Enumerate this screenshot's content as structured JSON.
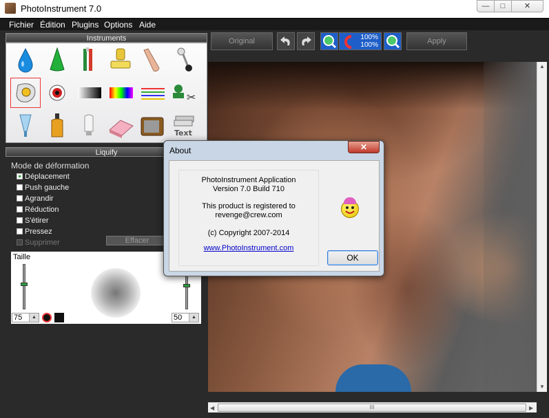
{
  "window": {
    "title": "PhotoInstrument 7.0",
    "min_glyph": "—",
    "max_glyph": "□",
    "close_glyph": "✕"
  },
  "menu": [
    "Fichier",
    "Édition",
    "Plugins",
    "Options",
    "Aide"
  ],
  "instruments": {
    "header": "Instruments"
  },
  "toolbar": {
    "original": "Original",
    "zoom_top": "100%",
    "zoom_bottom": "100%",
    "apply": "Apply"
  },
  "liquify": {
    "header": "Liquify",
    "mode_label": "Mode de déformation",
    "options": [
      "Déplacement",
      "Push gauche",
      "Agrandir",
      "Réduction",
      "S'étirer",
      "Pressez",
      "Supprimer"
    ],
    "selected": "Déplacement",
    "clear_button": "Effacer",
    "size_label": "Taille",
    "size_value": "75",
    "strength_value": "50"
  },
  "about": {
    "title": "About",
    "close_glyph": "✕",
    "app_name": "PhotoInstrument Application",
    "version": "Version 7.0 Build 710",
    "registered": "This product is registered to",
    "email": "revenge@crew.com",
    "copyright": "(c) Copyright 2007-2014",
    "website": "www.PhotoInstrument.com",
    "ok_label": "OK"
  },
  "icons": {
    "text_tool": "Text",
    "scroll_thumb_grip": "III",
    "arrow_up": "▲",
    "arrow_down": "▼",
    "arrow_left": "◀",
    "arrow_right": "▶"
  }
}
